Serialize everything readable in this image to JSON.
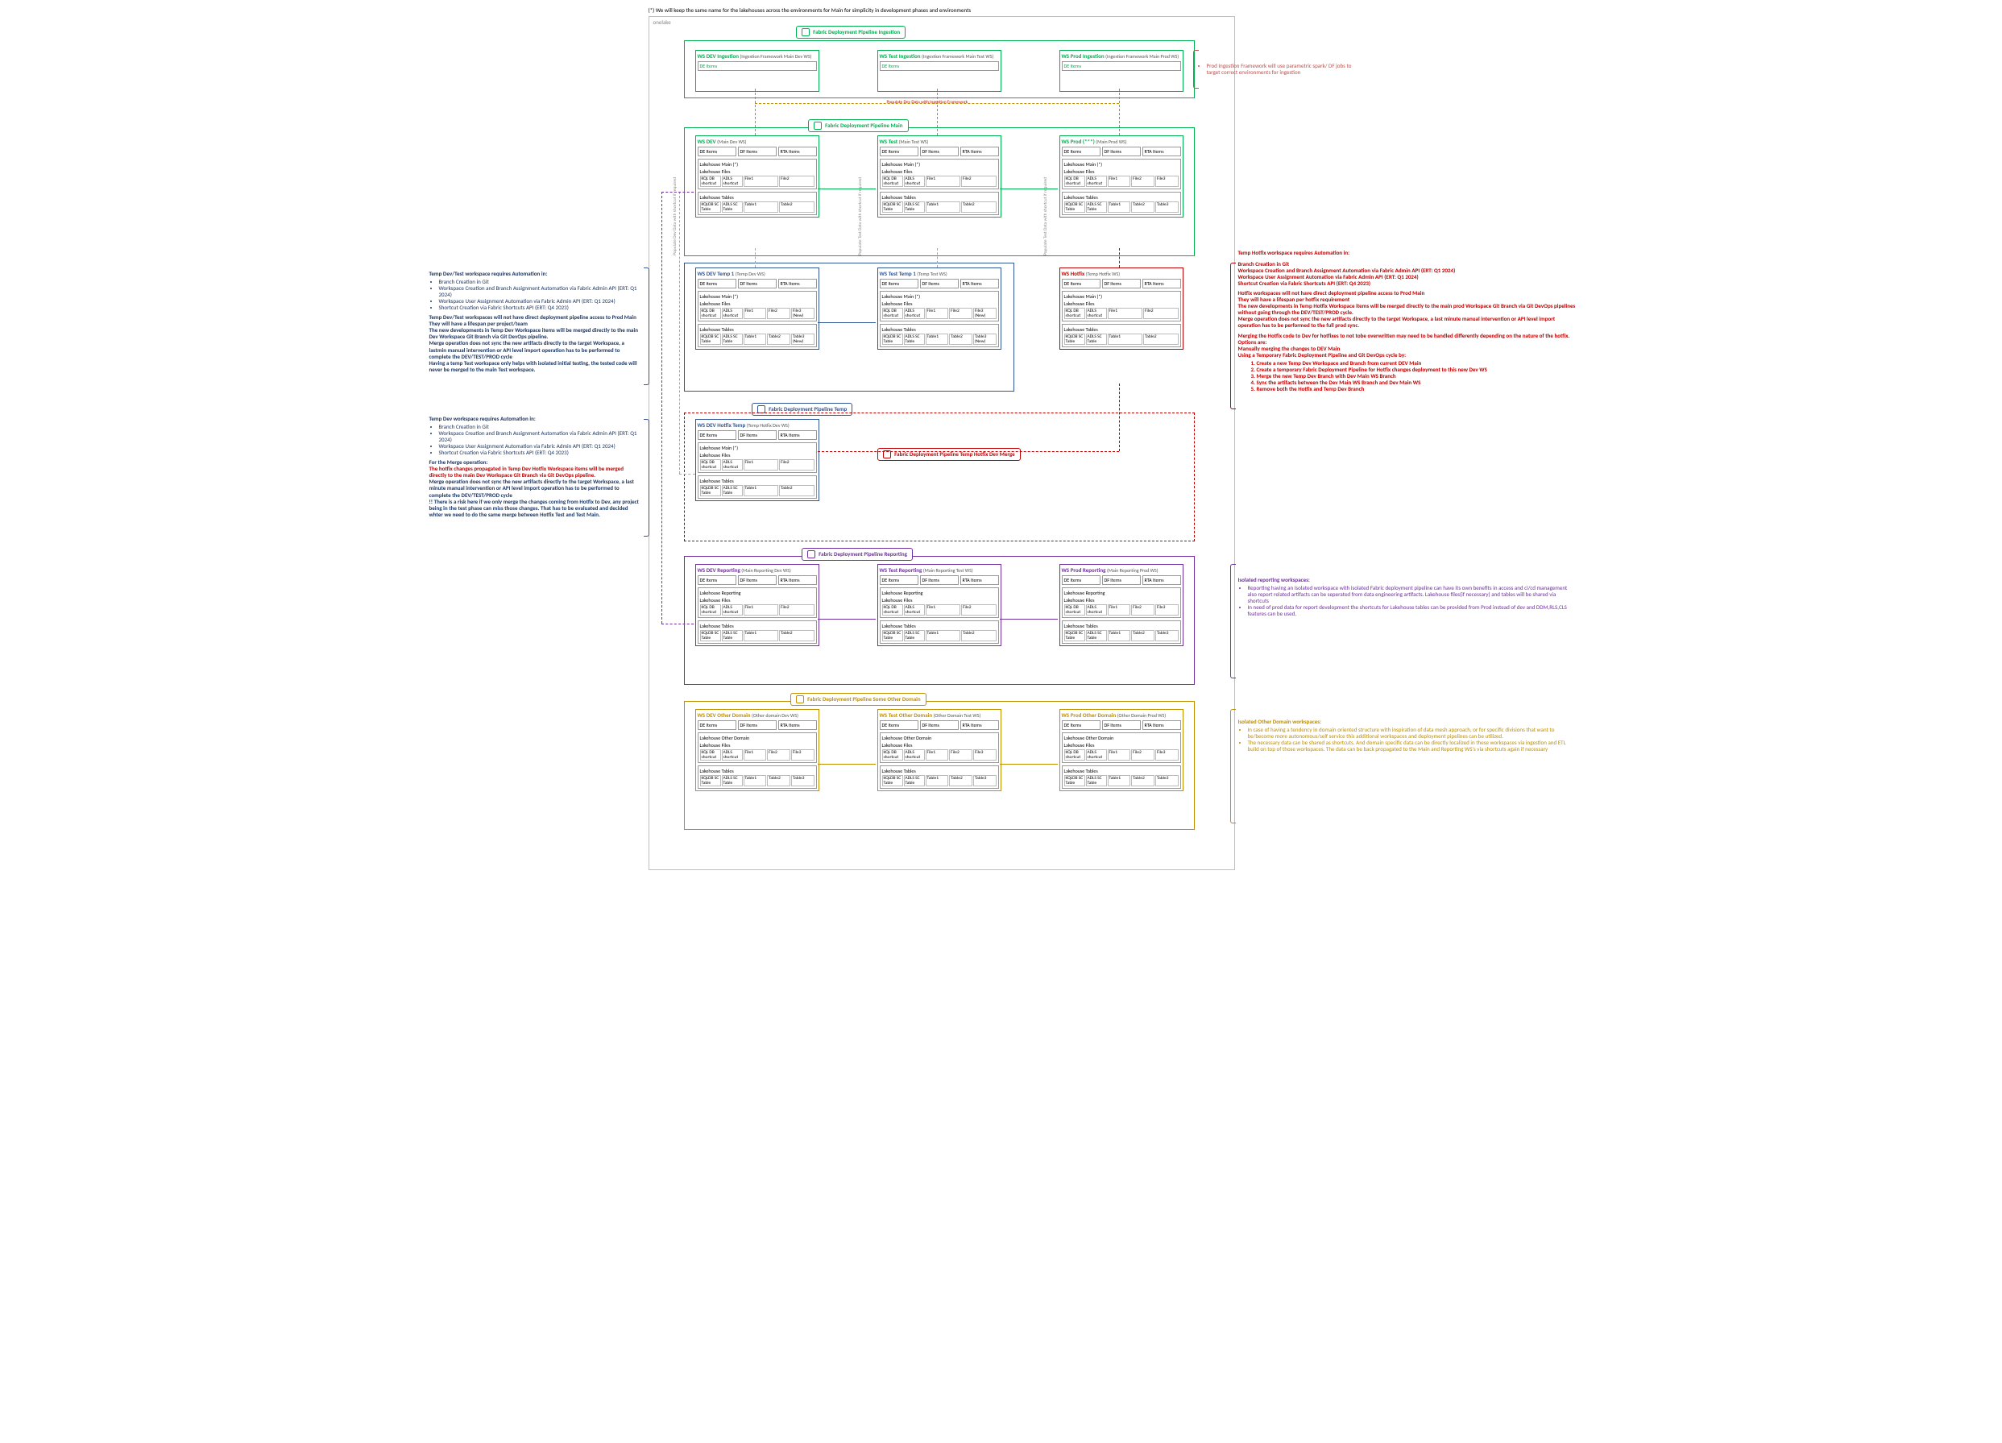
{
  "top_note": "(*) We will keep the same name for the lakehouses across the environments for Main for simplicity in development phases and environments",
  "onelake_label": "onelake",
  "pipelines": {
    "ingestion": "Fabric Deployment Pipeline Ingestion",
    "main": "Fabric Deployment Pipeline Main",
    "temp": "Fabric Deployment Pipeline Temp",
    "hotfix_devmerge": "Fabric Deployment Pipeline Temp Hotfix Dev Merge",
    "reporting": "Fabric Deployment Pipeline Reporting",
    "other": "Fabric Deployment Pipeline Some Other Domain"
  },
  "small_labels": {
    "populate_ing": "Populate Dev Data with Ingestion Framework",
    "populate_shortcut_left": "Populate Dev Data with shortcut if required",
    "populate_shortcut_right": "Populate Test Data with shortcut if required"
  },
  "ingestion_note_title": "",
  "ingestion_note": "Prod Ingestion Framework will use parametric spark/ DF jobs to target correct environments for ingestion",
  "ws_items": {
    "de": "DE Items",
    "df": "DF Items",
    "rta": "RTA Items"
  },
  "lh": {
    "main": "Lakehouse Main (*)",
    "files": "Lakehouse Files",
    "tables": "Lakehouse Tables",
    "reporting": "Lakehouse Reporting",
    "other": "Lakehouse Other Domain",
    "kqldb": "KQL DB\nshortcut",
    "adls": "ADLS\nshortcut",
    "file1": "File1",
    "file2": "File2",
    "file3": "File3",
    "file3new": "File3\n(New)",
    "kqldbsc": "KQLDB\nSC Table",
    "adlssc": "ADLS SC\nTable",
    "t1": "Table1",
    "t2": "Table2",
    "t3": "Table3",
    "t3new": "Table3\n(New)"
  },
  "ws": {
    "dev_ing": {
      "title": "WS DEV Ingestion",
      "sub": "(Ingestion Framework Main Dev WS)"
    },
    "test_ing": {
      "title": "WS Test Ingestion",
      "sub": "(Ingestion Framework Main Test WS)"
    },
    "prod_ing": {
      "title": "WS Prod Ingestion",
      "sub": "(Ingestion Framework Main Prod WS)"
    },
    "dev": {
      "title": "WS DEV",
      "sub": "(Main Dev WS)"
    },
    "test": {
      "title": "WS Test",
      "sub": "(Main Test WS)"
    },
    "prod": {
      "title": "WS Prod (***)",
      "sub": "(Main Prod WS)"
    },
    "dev_temp": {
      "title": "WS DEV Temp 1",
      "sub": "(Temp Dev WS)"
    },
    "test_temp": {
      "title": "WS Test Temp 1",
      "sub": "(Temp Test WS)"
    },
    "hotfix": {
      "title": "WS Hotfix",
      "sub": "(Temp Hotfix WS)"
    },
    "hotfix_temp": {
      "title": "WS DEV Hotfix Temp",
      "sub": "(Temp Hotfix Dev WS)"
    },
    "dev_rep": {
      "title": "WS DEV Reporting",
      "sub": "(Main Reporting Dev WS)"
    },
    "test_rep": {
      "title": "WS Test Reporting",
      "sub": "(Main Reporting Test WS)"
    },
    "prod_rep": {
      "title": "WS Prod Reporting",
      "sub": "(Main Reporting Prod WS)"
    },
    "dev_oth": {
      "title": "WS DEV Other Domain",
      "sub": "(Other domain Dev WS)"
    },
    "test_oth": {
      "title": "WS Test Other Domain",
      "sub": "(Other Domain Test WS)"
    },
    "prod_oth": {
      "title": "WS Prod Other Domain",
      "sub": "(Other Domain Prod WS)"
    }
  },
  "ann_left1": {
    "hdr": "Temp Dev/Test workspace requires Automation in:",
    "items": [
      "Branch Creation in Git",
      "Workspace Creation and Branch Assignment Automation  via Fabric Admin API  (ERT: Q1 2024)",
      "Workspace User Assignment Automation via Fabric Admin API (ERT: Q1 2024)",
      "Shortcut Creation via Fabric Shortcuts API (ERT: Q4 2023)"
    ],
    "p1": "Temp Dev/Test workspaces will not have direct deployment pipeline access to Prod Main",
    "p2": "They will have a lifespan per project/team",
    "p3": "The new developments in  Temp Dev Workspace items will be  merged directly to the main Dev Workspace Git Branch via Git DevOps pipeline.",
    "p4": "Merge operation does not sync the new artifacts directly to the target Workspace, a lastmin manual intervention or API level import operation has to be performed  to complete the DEV/TEST/PROD cycle",
    "p5": "Having a temp Test workspace only helps with isolated initial testing, the tested code will never be merged to the main Test workspace."
  },
  "ann_left2": {
    "hdr": "Temp Dev workspace requires Automation in:",
    "items": [
      "Branch Creation in Git",
      "Workspace Creation and Branch Assignment Automation  via Fabric Admin API  (ERT: Q1 2024)",
      "Workspace User Assignment Automation via Fabric Admin API (ERT: Q1 2024)",
      "Shortcut Creation via Fabric Shortcuts API (ERT: Q4 2023)"
    ],
    "p0": "For the Merge operation:",
    "p1r": "The hotfix changes propagated in  Temp Dev Hotfix Workspace items will be  merged directly to the main Dev Workspace Git Branch via Git DevOps pipeline.",
    "p2": "Merge operation does not sync the new artifacts directly to the target Workspace, a last minute manual intervention or API level import operation has to be performed  to complete the DEV/TEST/PROD cycle",
    "p3": "!! There is a risk here if we only merge the changes coming from  Hotfix to Dev, any project being in the test phase can miss those changes. That has to be evaluated and decided whter we need to do the same merge between  Hotfix Test and Test Main."
  },
  "ann_right_hotfix": {
    "hdr": "Temp Hotfix workspace requires Automation in:",
    "items": [
      "Branch Creation in Git",
      "Workspace Creation and Branch Assignment Automation  via Fabric Admin API (ERT: Q1 2024)",
      "Workspace User Assignment Automation via Fabric Admin API (ERT: Q1 2024)",
      "Shortcut Creation via Fabric Shortcuts API (ERT: Q4 2023)"
    ],
    "p1": "Hotfix workspaces will not have direct deployment pipeline access to Prod Main",
    "p2": "They will have a lifespan per hotfix requirement",
    "p3": "The new developments in  Temp Hotfix Workspace items will be  merged directly to the main prod Workspace Git Branch via Git DevOps pipelines  without going through the DEV/TEST/PROD cycle.",
    "p4": "Merge operation does not sync the new artifacts directly to the target Workspace, a last minute manual intervention or API level import operation has to be performed  to the full prod sync.",
    "p5": "Merging the Hotfix code to Dev for hotfixes to not tobe overwritten may need to be handled differently depending on the nature of the hotfix. Options are:",
    "o1": "Manually merging the changes to DEV Main",
    "o2": "Using a Temporary Fabric Deployment Pipeline and Git  DevOps cycle by:",
    "steps": [
      "1. Create a new Temp Dev Workspace and Branch from current DEV Main",
      "2. Create a temporary Fabric Deployment Pipeline for Hotfix changes deployment to this new Dev WS",
      "3. Merge the new Temp Dev Branch with Dev Main WS Branch",
      "4. Sync the artifacts between the   Dev Main WS Branch and  Dev Main WS",
      "5. Remove both the Hotfix and Temp Dev Branch"
    ]
  },
  "ann_right_reporting": {
    "hdr": "Isolated reporting workspaces:",
    "items": [
      "Reporting having an isolated workspace with isolated Fabric deployment pipeline can have its own benefits in access and ci/cd management also report related artifacts can be seperated from data engineering artifacts. Lakehouse files(if necessary)  and tables will be shared via shortcuts",
      "In need of prod data for report development the shortcuts for Lakehouse tables can be provided from Prod instead of dev and DDM,RLS,CLS features can be used."
    ]
  },
  "ann_right_other": {
    "hdr": "Isolated Other Domain workspaces:",
    "items": [
      "In case of having a tendency in domain oriented structure with inspiration of data mesh approach, or for specific divisions that want to be/become more autonomous/self service this additional workspaces and deployment pipelines can be utilized.",
      "The necessary data can be shared as shortcuts. And domain specific data can be directly localized in these workspaces via ingestion and ETL build on top of those workspaces. The data can be back propagated to the Main and Reporting  WS's  via shortcuts again if necessary"
    ]
  }
}
